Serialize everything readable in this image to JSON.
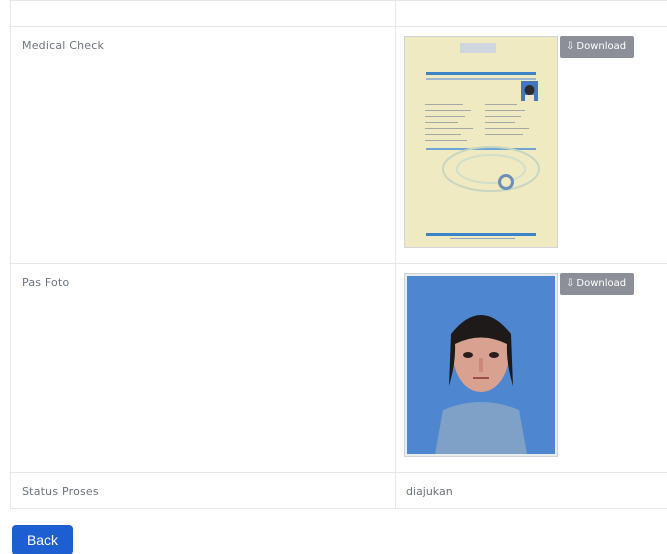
{
  "rows": [
    {
      "label": "Medical Check",
      "download_label": "Download"
    },
    {
      "label": "Pas Foto",
      "download_label": "Download"
    },
    {
      "label": "Status Proses",
      "value": "diajukan"
    }
  ],
  "actions": {
    "back_label": "Back"
  },
  "icons": {
    "download": "download-icon"
  }
}
